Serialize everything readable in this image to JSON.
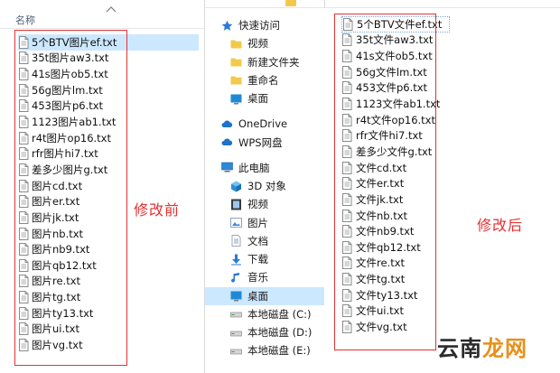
{
  "left_panel": {
    "column_header": "名称",
    "caption": "修改前",
    "files": [
      "5个BTV图片ef.txt",
      "35t图片aw3.txt",
      "41s图片ob5.txt",
      "56g图片lm.txt",
      "453图片p6.txt",
      "1123图片ab1.txt",
      "r4t图片op16.txt",
      "rfr图片hi7.txt",
      "差多少图片g.txt",
      "图片cd.txt",
      "图片er.txt",
      "图片jk.txt",
      "图片nb.txt",
      "图片nb9.txt",
      "图片qb12.txt",
      "图片re.txt",
      "图片tg.txt",
      "图片ty13.txt",
      "图片ui.txt",
      "图片vg.txt"
    ]
  },
  "right_window": {
    "caption": "修改后",
    "nav": [
      {
        "label": "快速访问",
        "icon": "star-icon",
        "level": 0
      },
      {
        "label": "视频",
        "icon": "folder-icon",
        "level": 1
      },
      {
        "label": "新建文件夹",
        "icon": "folder-icon",
        "level": 1
      },
      {
        "label": "重命名",
        "icon": "folder-icon",
        "level": 1
      },
      {
        "label": "桌面",
        "icon": "desktop-icon",
        "level": 1
      },
      {
        "label": "OneDrive",
        "icon": "cloud-icon",
        "level": 0
      },
      {
        "label": "WPS网盘",
        "icon": "cloud-icon",
        "level": 0
      },
      {
        "label": "此电脑",
        "icon": "computer-icon",
        "level": 0
      },
      {
        "label": "3D 对象",
        "icon": "cube-icon",
        "level": 1
      },
      {
        "label": "视频",
        "icon": "video-icon",
        "level": 1
      },
      {
        "label": "图片",
        "icon": "picture-icon",
        "level": 1
      },
      {
        "label": "文档",
        "icon": "document-icon",
        "level": 1
      },
      {
        "label": "下载",
        "icon": "download-icon",
        "level": 1
      },
      {
        "label": "音乐",
        "icon": "music-icon",
        "level": 1
      },
      {
        "label": "桌面",
        "icon": "desktop-icon",
        "level": 1,
        "active": true
      },
      {
        "label": "本地磁盘 (C:)",
        "icon": "drive-icon",
        "level": 1
      },
      {
        "label": "本地磁盘 (D:)",
        "icon": "drive-icon",
        "level": 1
      },
      {
        "label": "本地磁盘 (E:)",
        "icon": "drive-icon",
        "level": 1
      }
    ],
    "files": [
      "5个BTV文件ef.txt",
      "35t文件aw3.txt",
      "41s文件ob5.txt",
      "56g文件lm.txt",
      "453文件p6.txt",
      "1123文件ab1.txt",
      "r4t文件op16.txt",
      "rfr文件hi7.txt",
      "差多少文件g.txt",
      "文件cd.txt",
      "文件er.txt",
      "文件jk.txt",
      "文件nb.txt",
      "文件nb9.txt",
      "文件qb12.txt",
      "文件re.txt",
      "文件tg.txt",
      "文件ty13.txt",
      "文件ui.txt",
      "文件vg.txt"
    ]
  },
  "watermark": {
    "part1": "云南",
    "part2": "龙网"
  },
  "colors": {
    "annotation_red": "#e23232",
    "selection_blue": "#cce8ff",
    "folder_yellow": "#f2c94c"
  }
}
